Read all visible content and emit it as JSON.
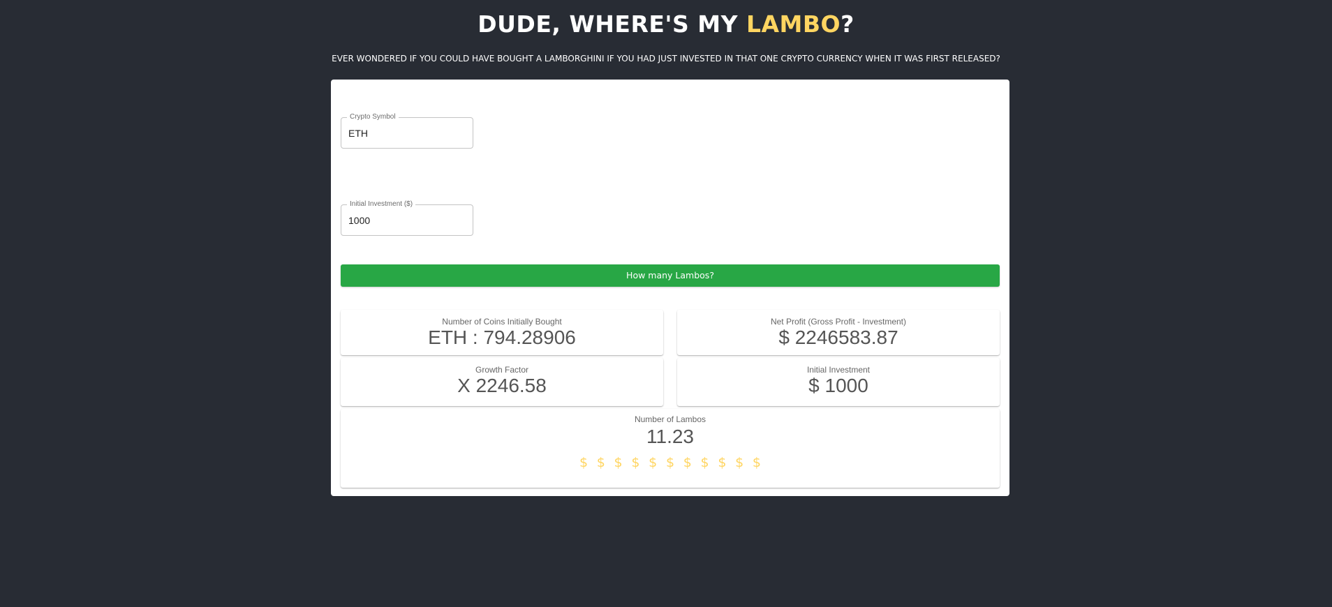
{
  "header": {
    "title_prefix": "DUDE, WHERE'S MY ",
    "title_accent": "LAMBO",
    "title_suffix": "?",
    "subtitle": "EVER WONDERED IF YOU COULD HAVE BOUGHT A LAMBORGHINI IF YOU HAD JUST INVESTED IN THAT ONE CRYPTO CURRENCY WHEN IT WAS FIRST RELEASED?"
  },
  "form": {
    "symbol_label": "Crypto Symbol",
    "symbol_value": "ETH",
    "investment_label": "Initial Investment ($)",
    "investment_value": "1000",
    "submit_label": "How many Lambos?"
  },
  "results": {
    "coins_label": "Number of Coins Initially Bought",
    "coins_value": "ETH : 794.28906",
    "profit_label": "Net Profit (Gross Profit - Investment)",
    "profit_value": "$ 2246583.87",
    "growth_label": "Growth Factor",
    "growth_value": "X 2246.58",
    "initial_label": "Initial Investment",
    "initial_value": "$ 1000",
    "lambos_label": "Number of Lambos",
    "lambos_value": "11.23",
    "lambo_icons": [
      "$",
      "$",
      "$",
      "$",
      "$",
      "$",
      "$",
      "$",
      "$",
      "$",
      "$"
    ]
  },
  "colors": {
    "background": "#282c34",
    "accent": "#ffd561",
    "button": "#28a745"
  }
}
